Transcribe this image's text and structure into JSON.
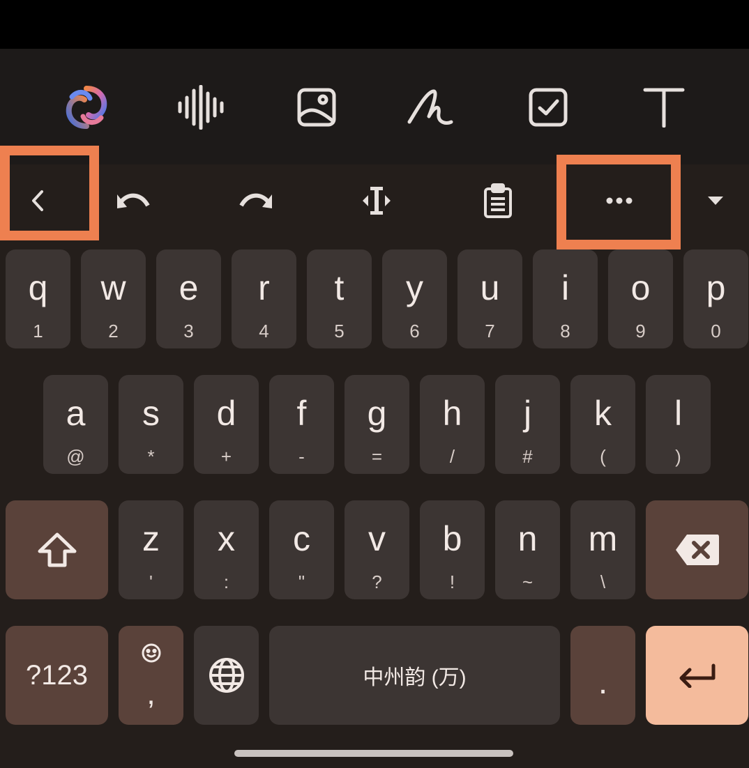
{
  "toolbar": {
    "icons": [
      "assistant-logo-icon",
      "voice-waveform-icon",
      "image-icon",
      "handwriting-icon",
      "checklist-icon",
      "text-format-icon"
    ]
  },
  "suggestion_bar": {
    "icons": [
      "back-chevron-icon",
      "undo-icon",
      "redo-icon",
      "cursor-move-icon",
      "clipboard-icon",
      "more-options-icon",
      "collapse-keyboard-icon"
    ],
    "highlight_color": "#ee8050"
  },
  "keyboard": {
    "row1": [
      {
        "main": "q",
        "sub": "1"
      },
      {
        "main": "w",
        "sub": "2"
      },
      {
        "main": "e",
        "sub": "3"
      },
      {
        "main": "r",
        "sub": "4"
      },
      {
        "main": "t",
        "sub": "5"
      },
      {
        "main": "y",
        "sub": "6"
      },
      {
        "main": "u",
        "sub": "7"
      },
      {
        "main": "i",
        "sub": "8"
      },
      {
        "main": "o",
        "sub": "9"
      },
      {
        "main": "p",
        "sub": "0"
      }
    ],
    "row2": [
      {
        "main": "a",
        "sub": "@"
      },
      {
        "main": "s",
        "sub": "*"
      },
      {
        "main": "d",
        "sub": "+"
      },
      {
        "main": "f",
        "sub": "-"
      },
      {
        "main": "g",
        "sub": "="
      },
      {
        "main": "h",
        "sub": "/"
      },
      {
        "main": "j",
        "sub": "#"
      },
      {
        "main": "k",
        "sub": "("
      },
      {
        "main": "l",
        "sub": ")"
      }
    ],
    "row3": [
      {
        "main": "z",
        "sub": "'"
      },
      {
        "main": "x",
        "sub": ":"
      },
      {
        "main": "c",
        "sub": "\""
      },
      {
        "main": "v",
        "sub": "?"
      },
      {
        "main": "b",
        "sub": "!"
      },
      {
        "main": "n",
        "sub": "~"
      },
      {
        "main": "m",
        "sub": "\\"
      }
    ],
    "symbols_label": "?123",
    "comma_label": ",",
    "space_label": "中州韵 (万)",
    "period_label": ".",
    "shift_icon": "shift-arrow-icon",
    "backspace_icon": "backspace-icon",
    "emoji_icon": "emoji-icon",
    "globe_icon": "globe-icon",
    "enter_icon": "enter-arrow-icon",
    "colors": {
      "key": "#3c3533",
      "function_key": "#5a423a",
      "enter_key": "#f4bb9c",
      "text": "#f2e9e5"
    }
  }
}
